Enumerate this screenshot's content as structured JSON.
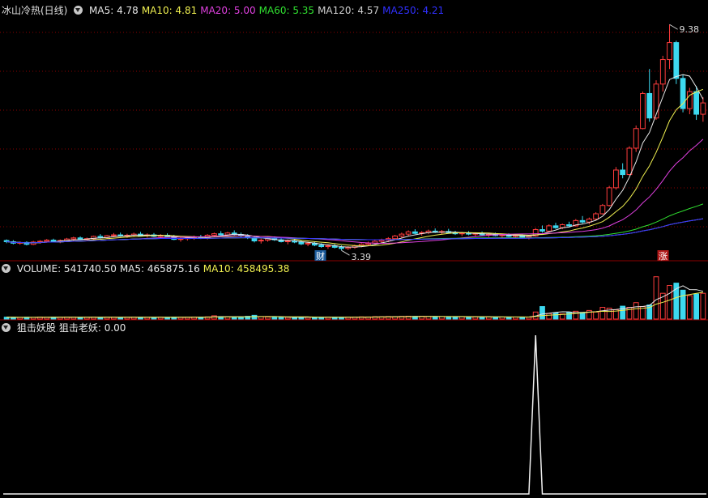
{
  "colors": {
    "up": "#ff3d3d",
    "down": "#3dd9f0",
    "ma5": "#e8e8e8",
    "ma10": "#f0f050",
    "ma20": "#e040e0",
    "ma60": "#30e030",
    "ma120": "#cfcfcf",
    "ma250": "#3030ff",
    "grid": "#8b0000"
  },
  "main_header": {
    "title": "冰山冷热(日线)",
    "items": [
      {
        "label": "MA5: 4.78",
        "color": "#e8e8e8"
      },
      {
        "label": "MA10: 4.81",
        "color": "#f0f050"
      },
      {
        "label": "MA20: 5.00",
        "color": "#e040e0"
      },
      {
        "label": "MA60: 5.35",
        "color": "#30e030"
      },
      {
        "label": "MA120: 4.57",
        "color": "#cfcfcf"
      },
      {
        "label": "MA250: 4.21",
        "color": "#3030ff"
      }
    ]
  },
  "volume_header": {
    "items": [
      {
        "label": "VOLUME: 541740.50",
        "color": "#e8e8e8"
      },
      {
        "label": "MA5: 465875.16",
        "color": "#e8e8e8"
      },
      {
        "label": "MA10: 458495.38",
        "color": "#f0f050"
      }
    ]
  },
  "indicator_header": {
    "items": [
      {
        "label": "狙击妖股",
        "color": "#e8e8e8"
      },
      {
        "label": "狙击老妖: 0.00",
        "color": "#e8e8e8"
      }
    ]
  },
  "chart_data": [
    {
      "type": "candlestick",
      "panel": "price",
      "y_range": [
        3.2,
        9.6
      ],
      "annotations": {
        "high_label": "9.38",
        "low_label": "3.39",
        "cai_marker": "财",
        "zhang_marker": "涨"
      },
      "candles": [
        [
          3.65,
          3.68,
          3.58,
          3.62
        ],
        [
          3.62,
          3.66,
          3.55,
          3.58
        ],
        [
          3.58,
          3.62,
          3.54,
          3.6
        ],
        [
          3.6,
          3.63,
          3.52,
          3.55
        ],
        [
          3.55,
          3.64,
          3.53,
          3.61
        ],
        [
          3.61,
          3.66,
          3.57,
          3.63
        ],
        [
          3.63,
          3.69,
          3.59,
          3.66
        ],
        [
          3.66,
          3.7,
          3.6,
          3.62
        ],
        [
          3.62,
          3.68,
          3.58,
          3.65
        ],
        [
          3.65,
          3.72,
          3.61,
          3.69
        ],
        [
          3.69,
          3.75,
          3.64,
          3.72
        ],
        [
          3.72,
          3.76,
          3.66,
          3.68
        ],
        [
          3.68,
          3.73,
          3.63,
          3.7
        ],
        [
          3.7,
          3.78,
          3.67,
          3.76
        ],
        [
          3.76,
          3.82,
          3.7,
          3.73
        ],
        [
          3.73,
          3.8,
          3.7,
          3.78
        ],
        [
          3.78,
          3.85,
          3.74,
          3.8
        ],
        [
          3.8,
          3.86,
          3.75,
          3.77
        ],
        [
          3.77,
          3.83,
          3.72,
          3.79
        ],
        [
          3.79,
          3.86,
          3.75,
          3.82
        ],
        [
          3.82,
          3.88,
          3.76,
          3.78
        ],
        [
          3.78,
          3.84,
          3.73,
          3.8
        ],
        [
          3.8,
          3.85,
          3.74,
          3.76
        ],
        [
          3.76,
          3.82,
          3.71,
          3.79
        ],
        [
          3.79,
          3.84,
          3.74,
          3.75
        ],
        [
          3.75,
          3.8,
          3.66,
          3.68
        ],
        [
          3.68,
          3.74,
          3.62,
          3.7
        ],
        [
          3.7,
          3.76,
          3.65,
          3.72
        ],
        [
          3.72,
          3.78,
          3.67,
          3.74
        ],
        [
          3.74,
          3.8,
          3.69,
          3.71
        ],
        [
          3.71,
          3.82,
          3.68,
          3.79
        ],
        [
          3.79,
          3.86,
          3.74,
          3.83
        ],
        [
          3.83,
          3.9,
          3.77,
          3.8
        ],
        [
          3.8,
          3.88,
          3.76,
          3.85
        ],
        [
          3.85,
          3.92,
          3.79,
          3.81
        ],
        [
          3.81,
          3.86,
          3.74,
          3.77
        ],
        [
          3.77,
          3.82,
          3.69,
          3.73
        ],
        [
          3.73,
          3.78,
          3.6,
          3.64
        ],
        [
          3.64,
          3.7,
          3.57,
          3.66
        ],
        [
          3.66,
          3.74,
          3.62,
          3.7
        ],
        [
          3.7,
          3.76,
          3.64,
          3.67
        ],
        [
          3.67,
          3.72,
          3.6,
          3.62
        ],
        [
          3.62,
          3.68,
          3.55,
          3.64
        ],
        [
          3.64,
          3.7,
          3.58,
          3.61
        ],
        [
          3.61,
          3.66,
          3.53,
          3.56
        ],
        [
          3.56,
          3.62,
          3.5,
          3.58
        ],
        [
          3.58,
          3.63,
          3.5,
          3.53
        ],
        [
          3.53,
          3.58,
          3.46,
          3.49
        ],
        [
          3.49,
          3.55,
          3.43,
          3.51
        ],
        [
          3.51,
          3.56,
          3.44,
          3.47
        ],
        [
          3.47,
          3.52,
          3.39,
          3.44
        ],
        [
          3.44,
          3.5,
          3.4,
          3.47
        ],
        [
          3.47,
          3.54,
          3.43,
          3.51
        ],
        [
          3.51,
          3.58,
          3.47,
          3.55
        ],
        [
          3.55,
          3.62,
          3.5,
          3.58
        ],
        [
          3.58,
          3.66,
          3.54,
          3.63
        ],
        [
          3.63,
          3.7,
          3.58,
          3.66
        ],
        [
          3.66,
          3.74,
          3.61,
          3.7
        ],
        [
          3.7,
          3.8,
          3.66,
          3.77
        ],
        [
          3.77,
          3.86,
          3.72,
          3.82
        ],
        [
          3.82,
          3.92,
          3.78,
          3.88
        ],
        [
          3.88,
          3.95,
          3.82,
          3.84
        ],
        [
          3.84,
          3.9,
          3.78,
          3.86
        ],
        [
          3.86,
          3.94,
          3.82,
          3.9
        ],
        [
          3.9,
          3.97,
          3.85,
          3.87
        ],
        [
          3.87,
          3.93,
          3.81,
          3.89
        ],
        [
          3.89,
          3.96,
          3.84,
          3.86
        ],
        [
          3.86,
          3.91,
          3.8,
          3.83
        ],
        [
          3.83,
          3.88,
          3.77,
          3.85
        ],
        [
          3.85,
          3.9,
          3.79,
          3.82
        ],
        [
          3.82,
          3.87,
          3.76,
          3.84
        ],
        [
          3.84,
          3.89,
          3.78,
          3.8
        ],
        [
          3.8,
          3.85,
          3.74,
          3.82
        ],
        [
          3.82,
          3.86,
          3.76,
          3.78
        ],
        [
          3.78,
          3.83,
          3.72,
          3.8
        ],
        [
          3.8,
          3.84,
          3.74,
          3.76
        ],
        [
          3.76,
          3.81,
          3.71,
          3.78
        ],
        [
          3.78,
          3.82,
          3.72,
          3.74
        ],
        [
          3.74,
          3.8,
          3.68,
          3.77
        ],
        [
          3.77,
          3.98,
          3.75,
          3.94
        ],
        [
          3.94,
          4.05,
          3.86,
          3.9
        ],
        [
          3.9,
          4.08,
          3.88,
          4.04
        ],
        [
          4.04,
          4.12,
          3.96,
          3.99
        ],
        [
          3.99,
          4.1,
          3.95,
          4.07
        ],
        [
          4.07,
          4.15,
          4.0,
          4.04
        ],
        [
          4.04,
          4.22,
          4.02,
          4.18
        ],
        [
          4.18,
          4.3,
          4.1,
          4.14
        ],
        [
          4.14,
          4.26,
          4.08,
          4.22
        ],
        [
          4.22,
          4.4,
          4.18,
          4.36
        ],
        [
          4.36,
          4.62,
          4.34,
          4.58
        ],
        [
          4.58,
          5.1,
          4.55,
          5.05
        ],
        [
          5.05,
          5.6,
          5.0,
          5.52
        ],
        [
          5.52,
          5.7,
          5.3,
          5.4
        ],
        [
          5.4,
          6.15,
          5.38,
          6.1
        ],
        [
          6.1,
          6.7,
          6.0,
          6.62
        ],
        [
          6.62,
          7.6,
          6.6,
          7.55
        ],
        [
          7.55,
          8.2,
          6.8,
          6.9
        ],
        [
          6.9,
          7.9,
          6.85,
          7.8
        ],
        [
          7.8,
          8.55,
          7.6,
          8.45
        ],
        [
          8.45,
          9.38,
          8.2,
          8.9
        ],
        [
          8.9,
          8.95,
          7.8,
          7.95
        ],
        [
          7.95,
          8.05,
          7.05,
          7.15
        ],
        [
          7.15,
          7.7,
          7.0,
          7.6
        ],
        [
          7.6,
          7.75,
          6.85,
          7.0
        ],
        [
          7.0,
          7.45,
          6.8,
          7.3
        ]
      ]
    },
    {
      "type": "bar",
      "panel": "volume",
      "y_range": [
        0,
        560000
      ],
      "values": [
        24000,
        22000,
        20000,
        23000,
        21000,
        25000,
        22000,
        24000,
        23000,
        26000,
        24000,
        22000,
        23000,
        25000,
        22000,
        24000,
        23000,
        21000,
        22000,
        24000,
        23000,
        22000,
        21000,
        23000,
        22000,
        24000,
        22000,
        23000,
        26000,
        24000,
        28000,
        42000,
        30000,
        27000,
        25000,
        24000,
        35000,
        48000,
        30000,
        26000,
        24000,
        23000,
        22000,
        24000,
        22000,
        23000,
        21000,
        22000,
        24000,
        23000,
        22000,
        24000,
        26000,
        28000,
        27000,
        30000,
        29000,
        32000,
        30000,
        34000,
        36000,
        33000,
        35000,
        32000,
        30000,
        31000,
        29000,
        28000,
        30000,
        27000,
        28000,
        26000,
        27000,
        25000,
        26000,
        27000,
        25000,
        26000,
        24000,
        90000,
        160000,
        70000,
        80000,
        65000,
        88000,
        100000,
        85000,
        110000,
        90000,
        150000,
        140000,
        120000,
        165000,
        150000,
        210000,
        160000,
        180000,
        541740,
        330000,
        430000,
        460000,
        370000,
        300000,
        320000,
        330000
      ]
    },
    {
      "type": "line",
      "panel": "indicator",
      "series": [
        {
          "name": "狙击老妖",
          "values": [
            0,
            0,
            0,
            0,
            0,
            0,
            0,
            0,
            0,
            0,
            0,
            0,
            0,
            0,
            0,
            0,
            0,
            0,
            0,
            0,
            0,
            0,
            0,
            0,
            0,
            0,
            0,
            0,
            0,
            0,
            0,
            0,
            0,
            0,
            0,
            0,
            0,
            0,
            0,
            0,
            0,
            0,
            0,
            0,
            0,
            0,
            0,
            0,
            0,
            0,
            0,
            0,
            0,
            0,
            0,
            0,
            0,
            0,
            0,
            0,
            0,
            0,
            0,
            0,
            0,
            0,
            0,
            0,
            0,
            0,
            0,
            0,
            0,
            0,
            0,
            0,
            0,
            0,
            0,
            1,
            0,
            0,
            0,
            0,
            0,
            0,
            0,
            0,
            0,
            0,
            0,
            0,
            0,
            0,
            0,
            0,
            0,
            0,
            0,
            0,
            0,
            0,
            0,
            0,
            0
          ]
        }
      ],
      "y_range": [
        0,
        1
      ]
    }
  ]
}
